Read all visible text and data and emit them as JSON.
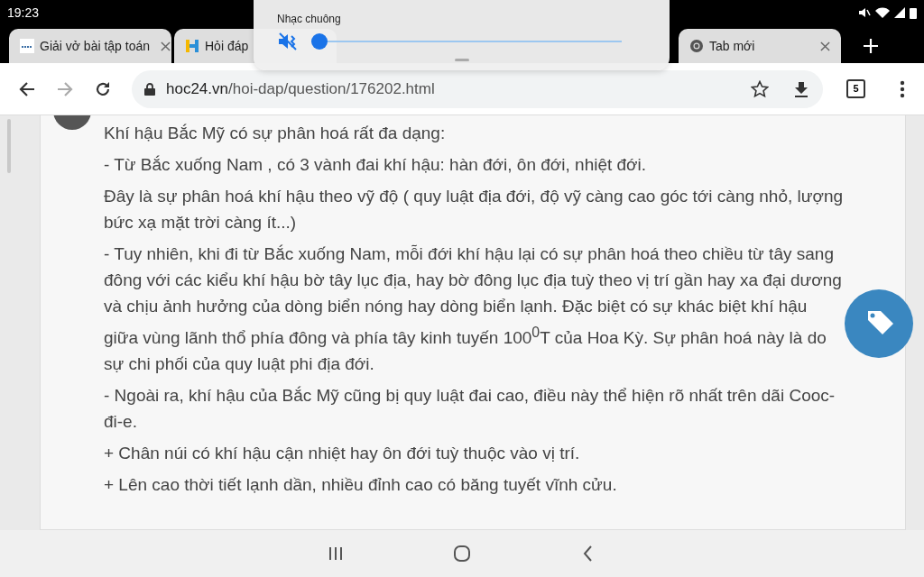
{
  "status_bar": {
    "time": "19:23"
  },
  "tabs": [
    {
      "title": "Giải vở bài tập toán"
    },
    {
      "title": "Hỏi đáp"
    },
    {
      "title": "Tab mới"
    }
  ],
  "volume_panel": {
    "label": "Nhạc chuông",
    "muted": true,
    "level": 0
  },
  "toolbar": {
    "url_host": "hoc24.vn",
    "url_path": "/hoi-dap/question/176202.html",
    "tab_count": "5"
  },
  "answer": {
    "paragraphs": [
      "Khí hậu Bắc Mỹ có sự phân hoá rất đa dạng:",
      "- Từ Bắc xuống Nam , có 3 vành đai khí hậu: hàn đới, ôn đới, nhiệt đới.",
      "Đây là sự phân hoá khí hậu theo vỹ độ ( quy luật địa đới, độ vỹ càng cao góc tới càng nhỏ, lượng bức xạ mặt trời càng ít...)",
      "- Tuy nhiên, khi đi từ Bắc xuống Nam, mỗi đới khí hậu lại có sự phân hoá theo chiều từ tây sang đông với các kiểu khí hậu bờ tây lục địa, hay bờ đông lục địa tuỳ theo vị trí gần hay xa đại dương và chịu ảnh hưởng của dòng biển nóng hay dòng biển lạnh. Đặc biệt có sự khác biệt khí hậu giữa vùng lãnh thổ phía đông và phía tây kinh tuyến 100$^{0}$T của Hoa Kỳ. Sự phân hoá này là do sự chi phối của quy luật phi địa đới.",
      "- Ngoài ra, khí hậu của Bắc Mỹ cũng bị quy luật đai cao, điều này thể hiện rõ nhất trên dãi Cooc-đi-e.",
      "+ Chân núi có khí hậu cận nhiệt hay ôn đới tuỳ thuộc vào vị trí.",
      "+ Lên cao thời tiết lạnh dần, nhiều đỉnh cao có băng tuyết vĩnh cửu."
    ]
  }
}
